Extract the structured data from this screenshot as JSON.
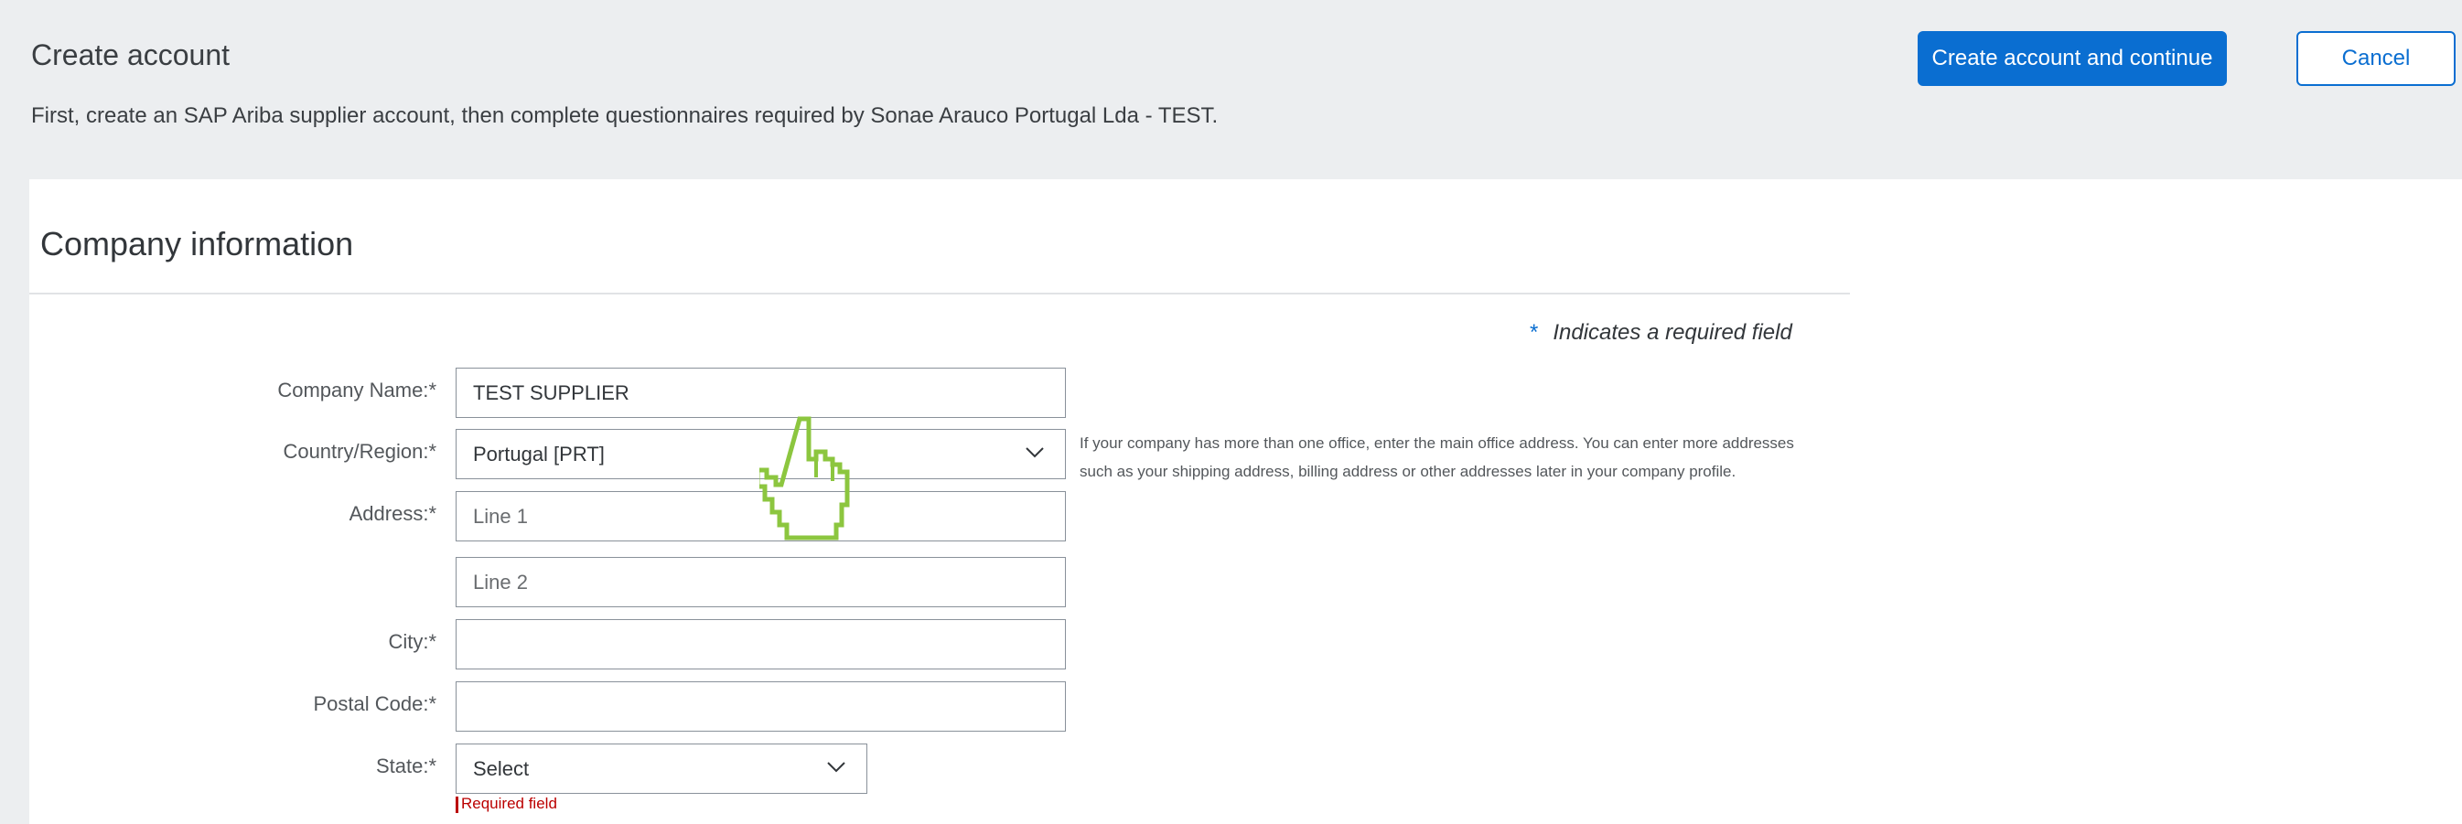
{
  "header": {
    "title": "Create account",
    "subtitle": "First, create an SAP Ariba supplier account, then complete questionnaires required by Sonae Arauco Portugal Lda - TEST.",
    "primary_button": "Create account and continue",
    "cancel_button": "Cancel"
  },
  "section": {
    "title": "Company information",
    "required_note": "Indicates a required field",
    "required_star": "*"
  },
  "form": {
    "company_name": {
      "label": "Company Name:",
      "value": "TEST SUPPLIER"
    },
    "country": {
      "label": "Country/Region:",
      "value": "Portugal  [PRT]"
    },
    "address": {
      "label": "Address:",
      "line1_placeholder": "Line 1",
      "line2_placeholder": "Line 2"
    },
    "city": {
      "label": "City:",
      "value": ""
    },
    "postal_code": {
      "label": "Postal Code:",
      "value": ""
    },
    "state": {
      "label": "State:",
      "value": "Select",
      "error": "Required field"
    },
    "required_marker": "*"
  },
  "helper_text": "If your company has more than one office, enter the main office address. You can enter more addresses such as your shipping address, billing address or other addresses later in your company profile.",
  "colors": {
    "accent": "#0a6ed1",
    "cursor": "#8cc63f",
    "error": "#bb0000"
  },
  "icons": {
    "dropdown": "chevron-down-icon",
    "pointer": "hand-pointer-icon"
  }
}
